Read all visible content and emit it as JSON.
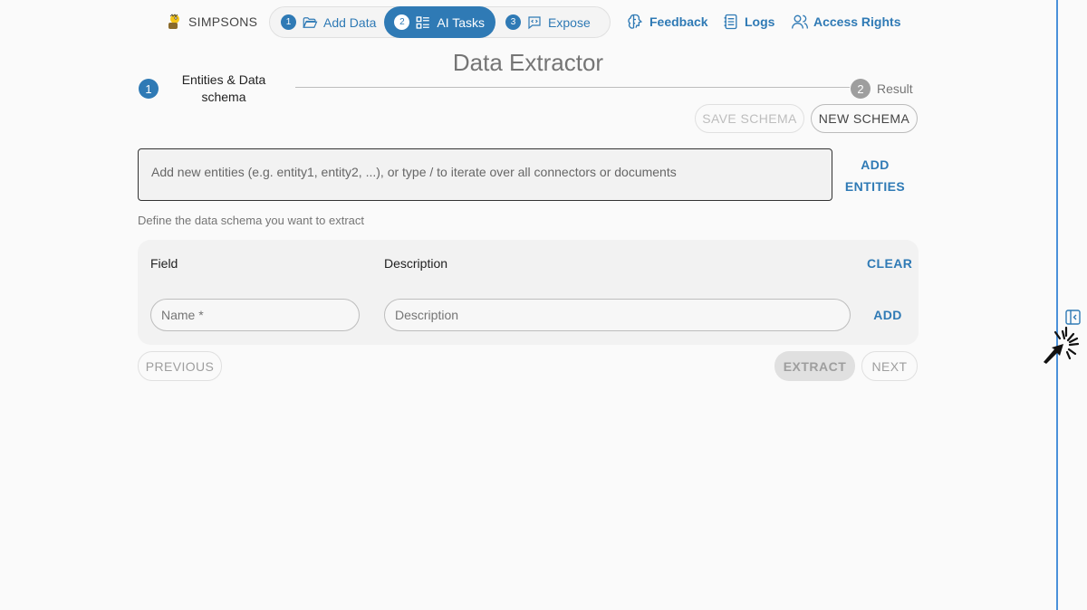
{
  "brand": {
    "name": "SIMPSONS"
  },
  "steps": [
    {
      "num": "1",
      "label": "Add Data",
      "icon": "folder-open-icon",
      "active": false
    },
    {
      "num": "2",
      "label": "AI Tasks",
      "icon": "tasks-grid-icon",
      "active": true
    },
    {
      "num": "3",
      "label": "Expose",
      "icon": "chat-code-icon",
      "active": false
    }
  ],
  "nav": {
    "feedback": {
      "label": "Feedback",
      "icon": "brain-icon"
    },
    "logs": {
      "label": "Logs",
      "icon": "logs-list-icon"
    },
    "access": {
      "label": "Access Rights",
      "icon": "users-icon"
    }
  },
  "page": {
    "title": "Data Extractor"
  },
  "stepper": [
    {
      "num": "1",
      "label": "Entities & Data schema",
      "active": true
    },
    {
      "num": "2",
      "label": "Result",
      "active": false
    }
  ],
  "buttons": {
    "save_schema": "SAVE SCHEMA",
    "new_schema": "NEW SCHEMA",
    "add_entities": "ADD ENTITIES",
    "clear": "CLEAR",
    "add": "ADD",
    "previous": "PREVIOUS",
    "extract": "EXTRACT",
    "next": "NEXT"
  },
  "entities_input": {
    "placeholder": "Add new entities (e.g. entity1, entity2, ...), or type / to iterate over all connectors or documents"
  },
  "schema": {
    "hint": "Define the data schema you want to extract",
    "columns": {
      "field": "Field",
      "description": "Description"
    },
    "name_placeholder": "Name *",
    "description_placeholder": "Description"
  },
  "colors": {
    "accent": "#2f7ab5",
    "disabled": "#bdbdbd",
    "edge_rule": "#4a90d9"
  }
}
